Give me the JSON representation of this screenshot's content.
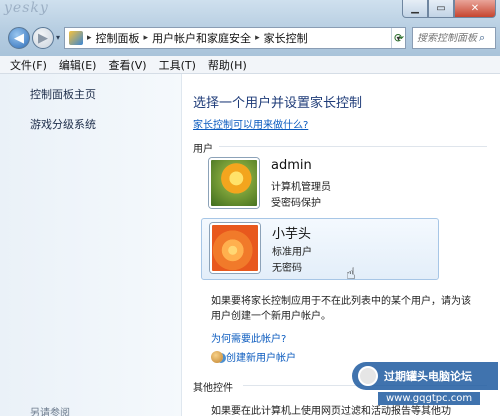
{
  "watermark_top": "yesky",
  "window": {
    "minimize_icon": "minimize-icon",
    "maximize_icon": "maximize-icon",
    "close_icon": "close-icon"
  },
  "nav": {
    "back_icon": "arrow-left-icon",
    "forward_icon": "arrow-right-icon"
  },
  "address": {
    "breadcrumbs": [
      "控制面板",
      "用户帐户和家庭安全",
      "家长控制"
    ]
  },
  "search": {
    "placeholder": "搜索控制面板"
  },
  "menu": [
    "文件(F)",
    "编辑(E)",
    "查看(V)",
    "工具(T)",
    "帮助(H)"
  ],
  "sidebar": {
    "links": [
      "控制面板主页",
      "游戏分级系统"
    ],
    "see_also": "另请参阅"
  },
  "main": {
    "heading": "选择一个用户并设置家长控制",
    "help_link": "家长控制可以用来做什么?",
    "users_label": "用户",
    "users": [
      {
        "name": "admin",
        "role": "计算机管理员",
        "password": "受密码保护"
      },
      {
        "name": "小芋头",
        "role": "标准用户",
        "password": "无密码"
      }
    ],
    "note": "如果要将家长控制应用于不在此列表中的某个用户，请为该用户创建一个新用户帐户。",
    "why_link": "为何需要此帐户?",
    "create_user": "创建新用户帐户",
    "other_label": "其他控件",
    "bottom_text": "如果要在此计算机上使用网页过滤和活动报告等其他功"
  },
  "watermark": {
    "text": "过期罐头电脑论坛",
    "url": "www.gqgtpc.com"
  },
  "colors": {
    "accent_link": "#0b5bbf",
    "heading": "#1e3b78"
  }
}
